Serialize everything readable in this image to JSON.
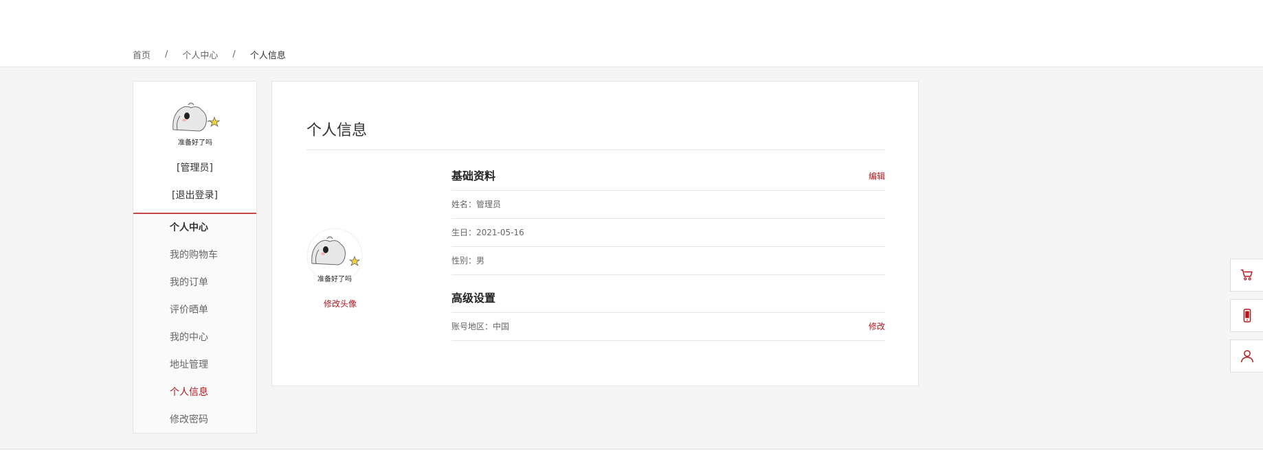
{
  "breadcrumb": {
    "home": "首页",
    "center": "个人中心",
    "current": "个人信息",
    "separator": "/"
  },
  "sidebar": {
    "avatar_caption": "准备好了吗",
    "role": "[管理员]",
    "logout": "[退出登录]",
    "menu": [
      {
        "label": "个人中心"
      },
      {
        "label": "我的购物车"
      },
      {
        "label": "我的订单"
      },
      {
        "label": "评价晒单"
      },
      {
        "label": "我的中心"
      },
      {
        "label": "地址管理"
      },
      {
        "label": "个人信息"
      },
      {
        "label": "修改密码"
      }
    ]
  },
  "main": {
    "title": "个人信息",
    "avatar_caption": "准备好了吗",
    "change_avatar": "修改头像",
    "basic": {
      "title": "基础资料",
      "edit": "编辑",
      "name": "姓名：管理员",
      "birthday": "生日：2021-05-16",
      "gender": "性别：男"
    },
    "advanced": {
      "title": "高级设置",
      "region": "账号地区：中国",
      "modify": "修改"
    }
  },
  "float_bar": {
    "icons": [
      "cart-icon",
      "phone-icon",
      "user-icon"
    ]
  },
  "colors": {
    "accent": "#b0171d",
    "sidebar_rule": "#c9474b"
  }
}
